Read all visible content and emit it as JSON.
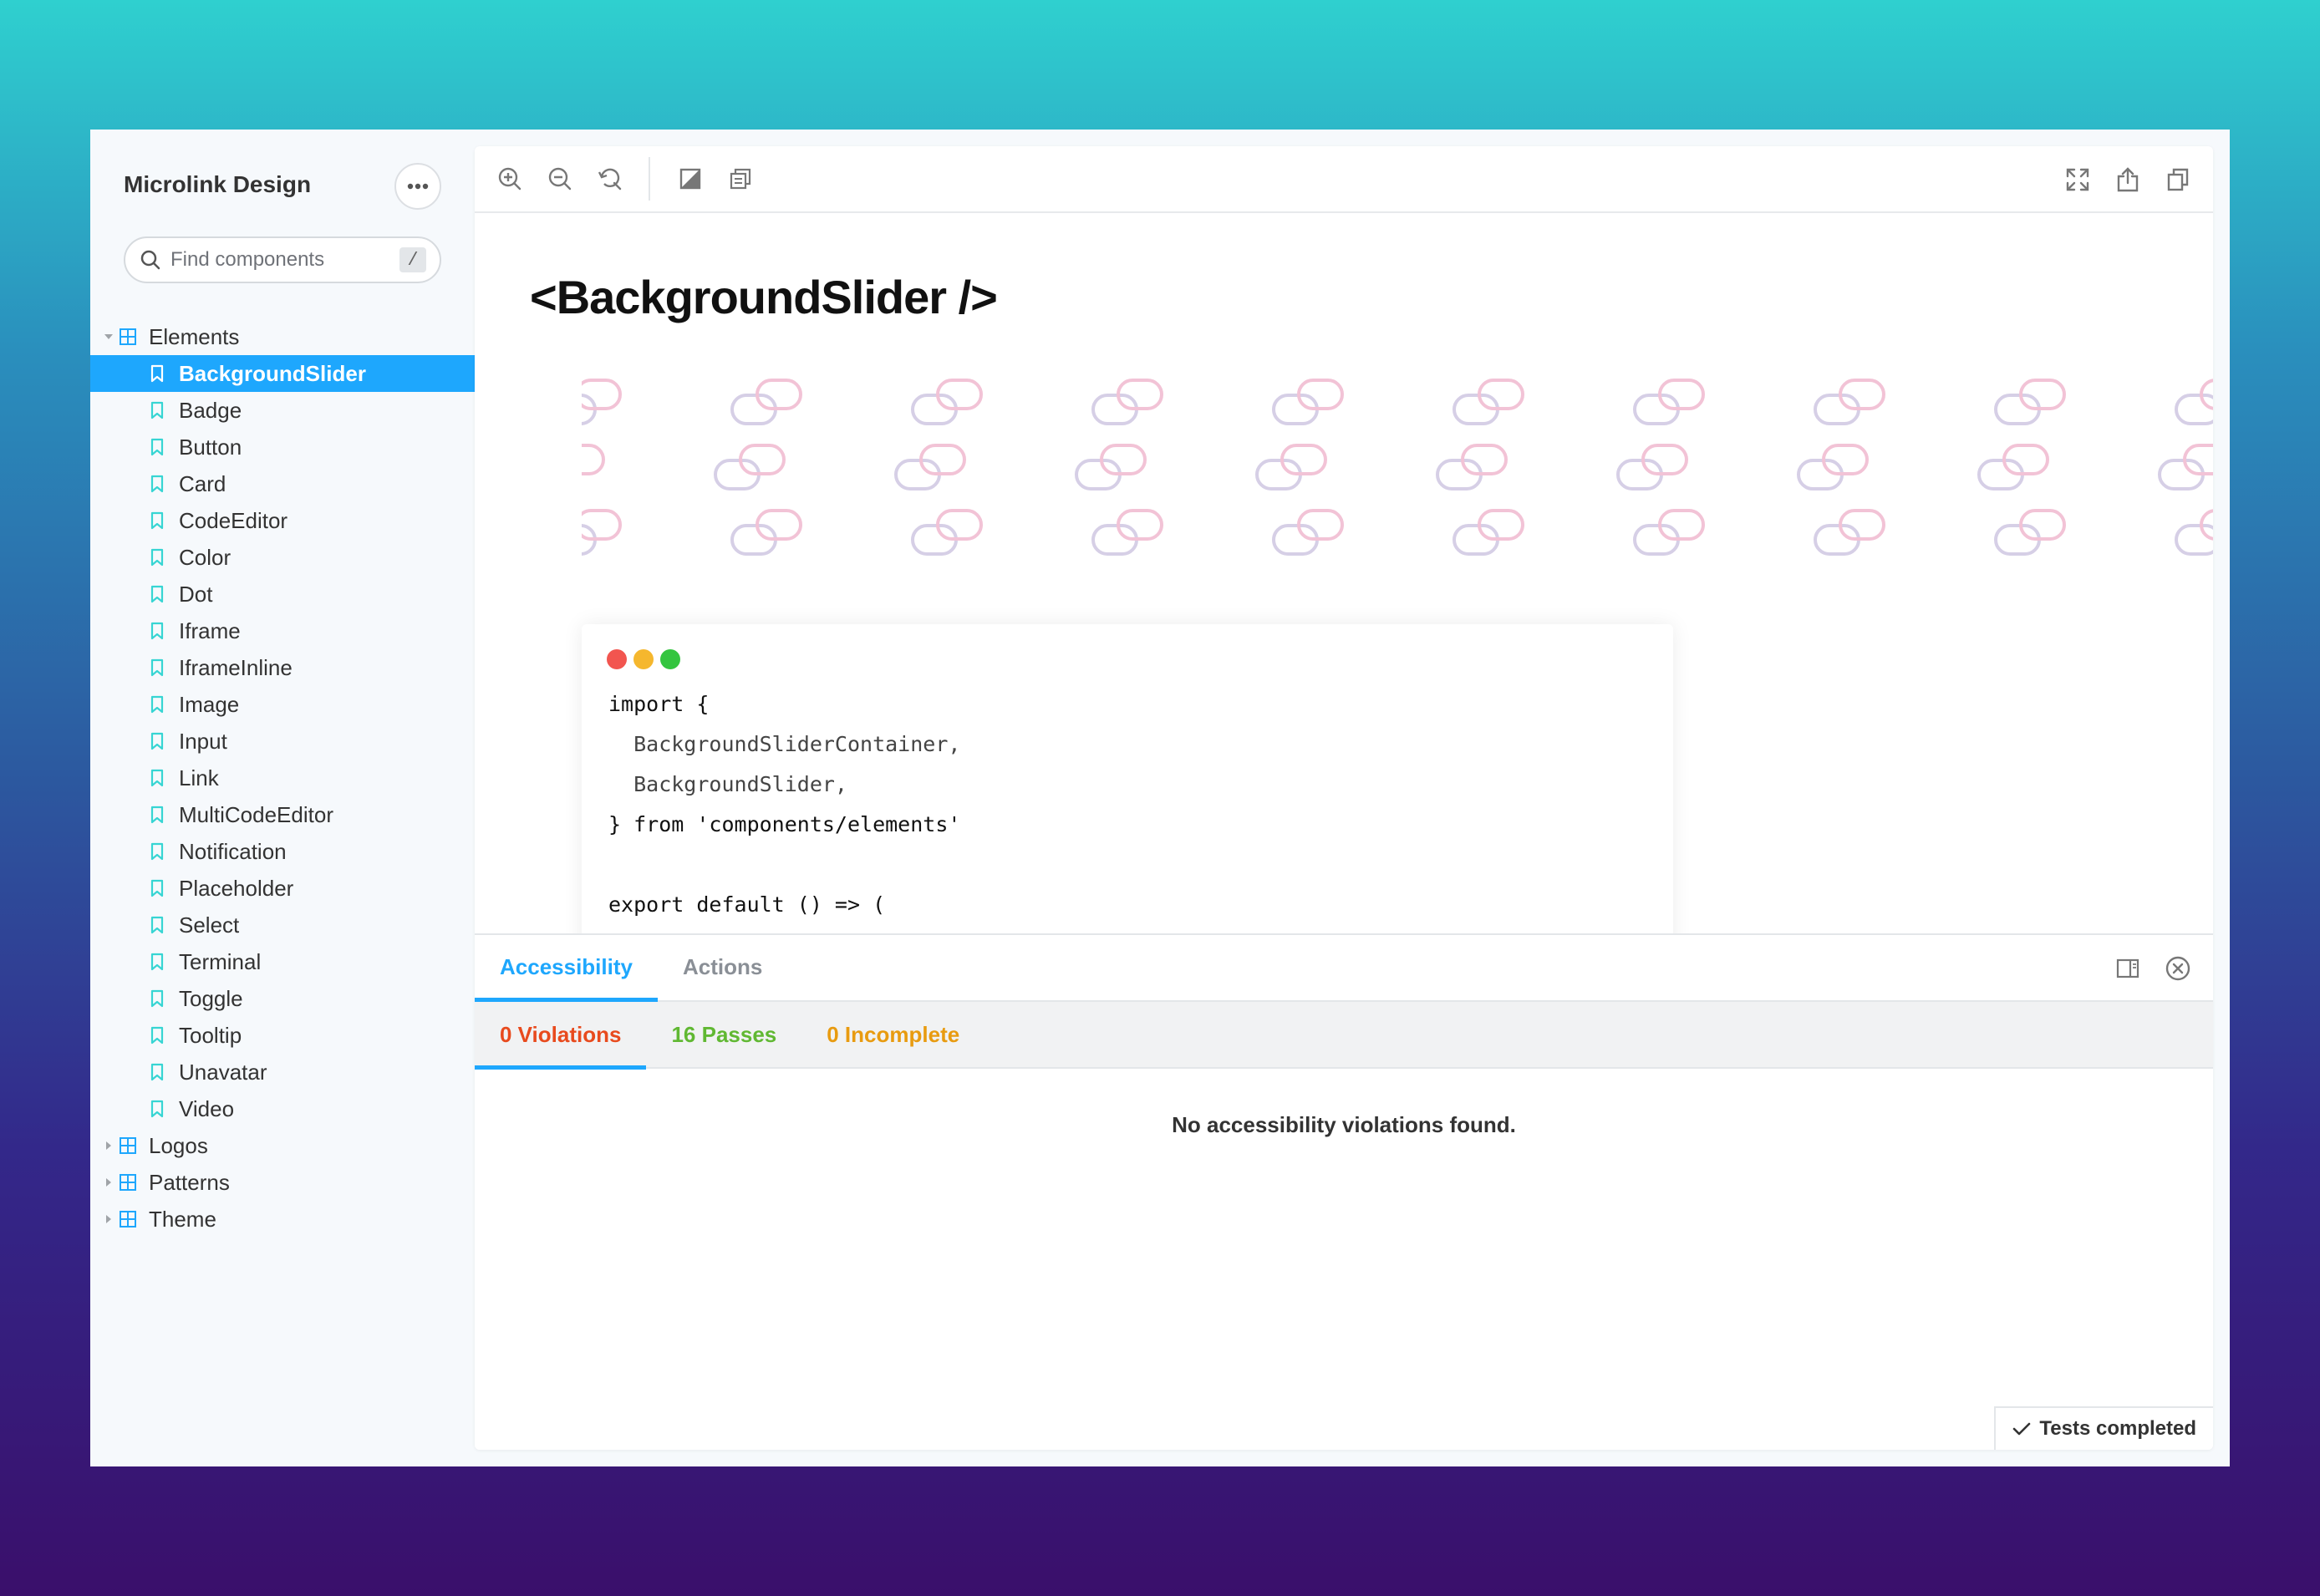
{
  "sidebar": {
    "brand": "Microlink Design",
    "search": {
      "placeholder": "Find components",
      "shortcut": "/"
    },
    "groups": [
      {
        "label": "Elements",
        "expanded": true,
        "items": [
          "BackgroundSlider",
          "Badge",
          "Button",
          "Card",
          "CodeEditor",
          "Color",
          "Dot",
          "Iframe",
          "IframeInline",
          "Image",
          "Input",
          "Link",
          "MultiCodeEditor",
          "Notification",
          "Placeholder",
          "Select",
          "Terminal",
          "Toggle",
          "Tooltip",
          "Unavatar",
          "Video"
        ],
        "selected": "BackgroundSlider"
      },
      {
        "label": "Logos",
        "expanded": false
      },
      {
        "label": "Patterns",
        "expanded": false
      },
      {
        "label": "Theme",
        "expanded": false
      }
    ]
  },
  "canvas": {
    "title": "<BackgroundSlider />",
    "code_lines": [
      "import {",
      "  BackgroundSliderContainer,",
      "  BackgroundSlider,",
      "} from 'components/elements'",
      "",
      "export default () => ("
    ],
    "window_dots": [
      "#f2554f",
      "#f5b72e",
      "#34c53f"
    ]
  },
  "addons": {
    "tabs": [
      "Accessibility",
      "Actions"
    ],
    "active_tab": "Accessibility",
    "subtabs": [
      {
        "label": "0 Violations",
        "color": "#e84a1d"
      },
      {
        "label": "16 Passes",
        "color": "#60b832"
      },
      {
        "label": "0 Incomplete",
        "color": "#e89b10"
      }
    ],
    "message": "No accessibility violations found.",
    "status": "Tests completed"
  },
  "colors": {
    "accent": "#1ea7fd",
    "leaf_icon": "#37d5d3"
  }
}
